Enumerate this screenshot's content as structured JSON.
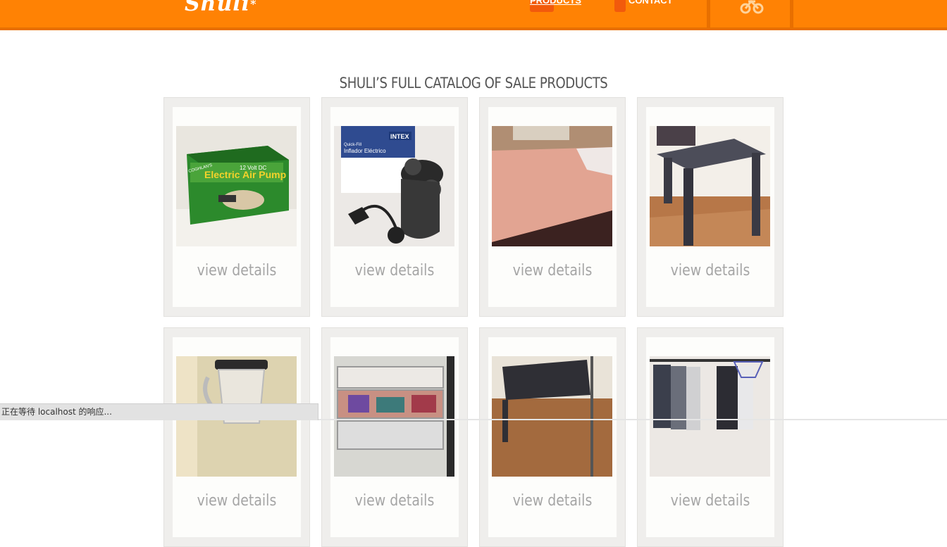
{
  "header": {
    "logo_text": "Shuli",
    "logo_mark": "*",
    "nav": [
      {
        "label": "Products",
        "icon": "cart-icon",
        "active": true
      },
      {
        "label": "Contact",
        "icon": "phone-icon",
        "active": false
      }
    ],
    "cart_icon": "bicycle-cart-icon",
    "colors": {
      "bar": "#ff8204",
      "bar_border": "#e86f00",
      "icon_accent": "#f25a0c"
    }
  },
  "page_title": "SHULI’S FULL CATALOG OF SALE PRODUCTS",
  "products": [
    {
      "image": "electric-air-pump-box",
      "box_title": "Electric Air Pump",
      "box_brand": "COGHLAN'S",
      "box_sub": "12 Volt DC",
      "link": "view details"
    },
    {
      "image": "intex-electric-pump",
      "box_title": "INTEX",
      "box_sub": "Inflador Eléctrico",
      "box_brand": "Quick-Fill",
      "link": "view details"
    },
    {
      "image": "bed-with-pink-sheet",
      "link": "view details"
    },
    {
      "image": "dark-side-table",
      "link": "view details"
    },
    {
      "image": "blender",
      "link": "view details"
    },
    {
      "image": "plastic-drawer-organizer",
      "link": "view details"
    },
    {
      "image": "black-chair",
      "link": "view details"
    },
    {
      "image": "clothes-rack",
      "link": "view details"
    }
  ],
  "status_bar": {
    "text": "正在等待 localhost 的响应..."
  }
}
